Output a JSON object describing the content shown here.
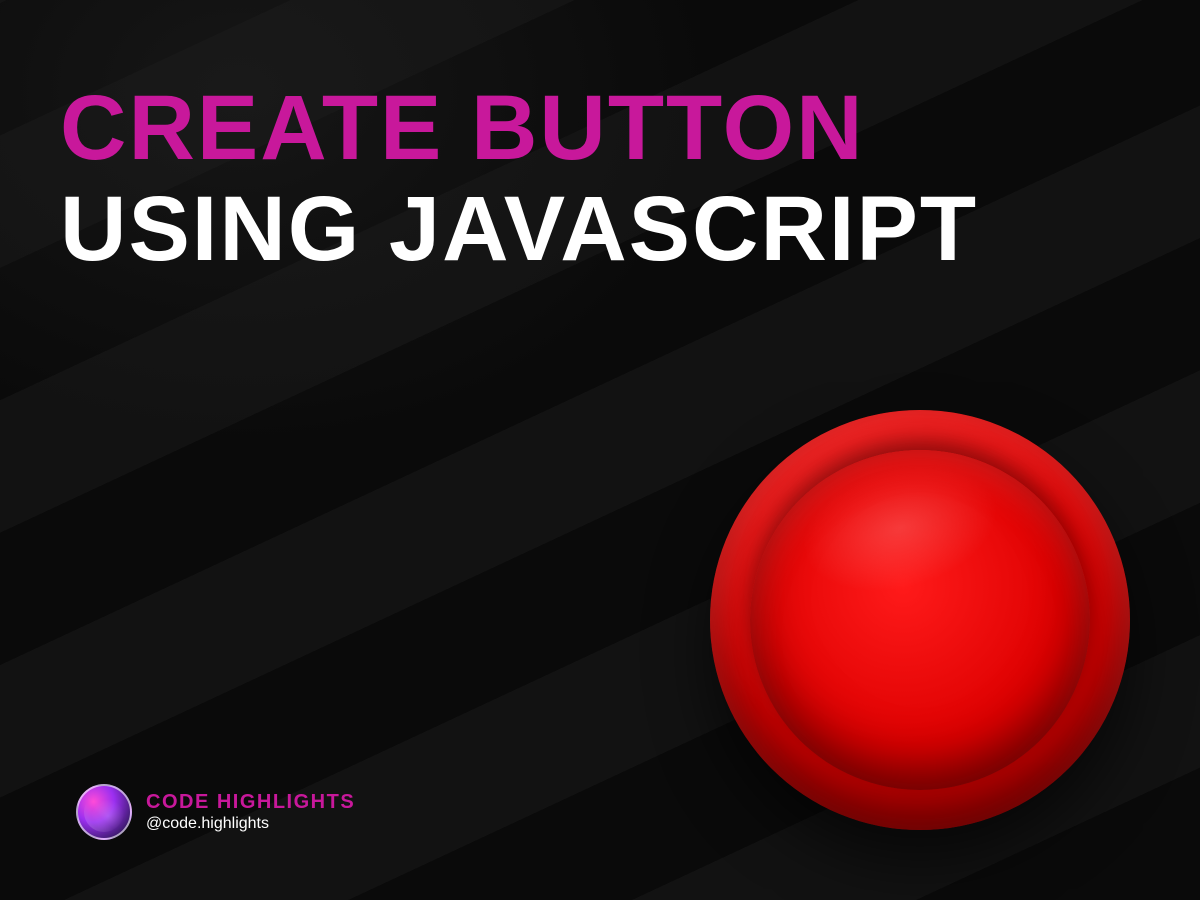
{
  "title": {
    "line1": "CREATE BUTTON",
    "line2": "USING JAVASCRIPT"
  },
  "footer": {
    "brand": "CODE HIGHLIGHTS",
    "handle": "@code.highlights"
  },
  "colors": {
    "accent": "#c8189b",
    "button": "#e60000",
    "text": "#ffffff",
    "background": "#0d0d0d"
  },
  "icons": {
    "avatar": "brain-character-icon",
    "main": "red-push-button"
  }
}
